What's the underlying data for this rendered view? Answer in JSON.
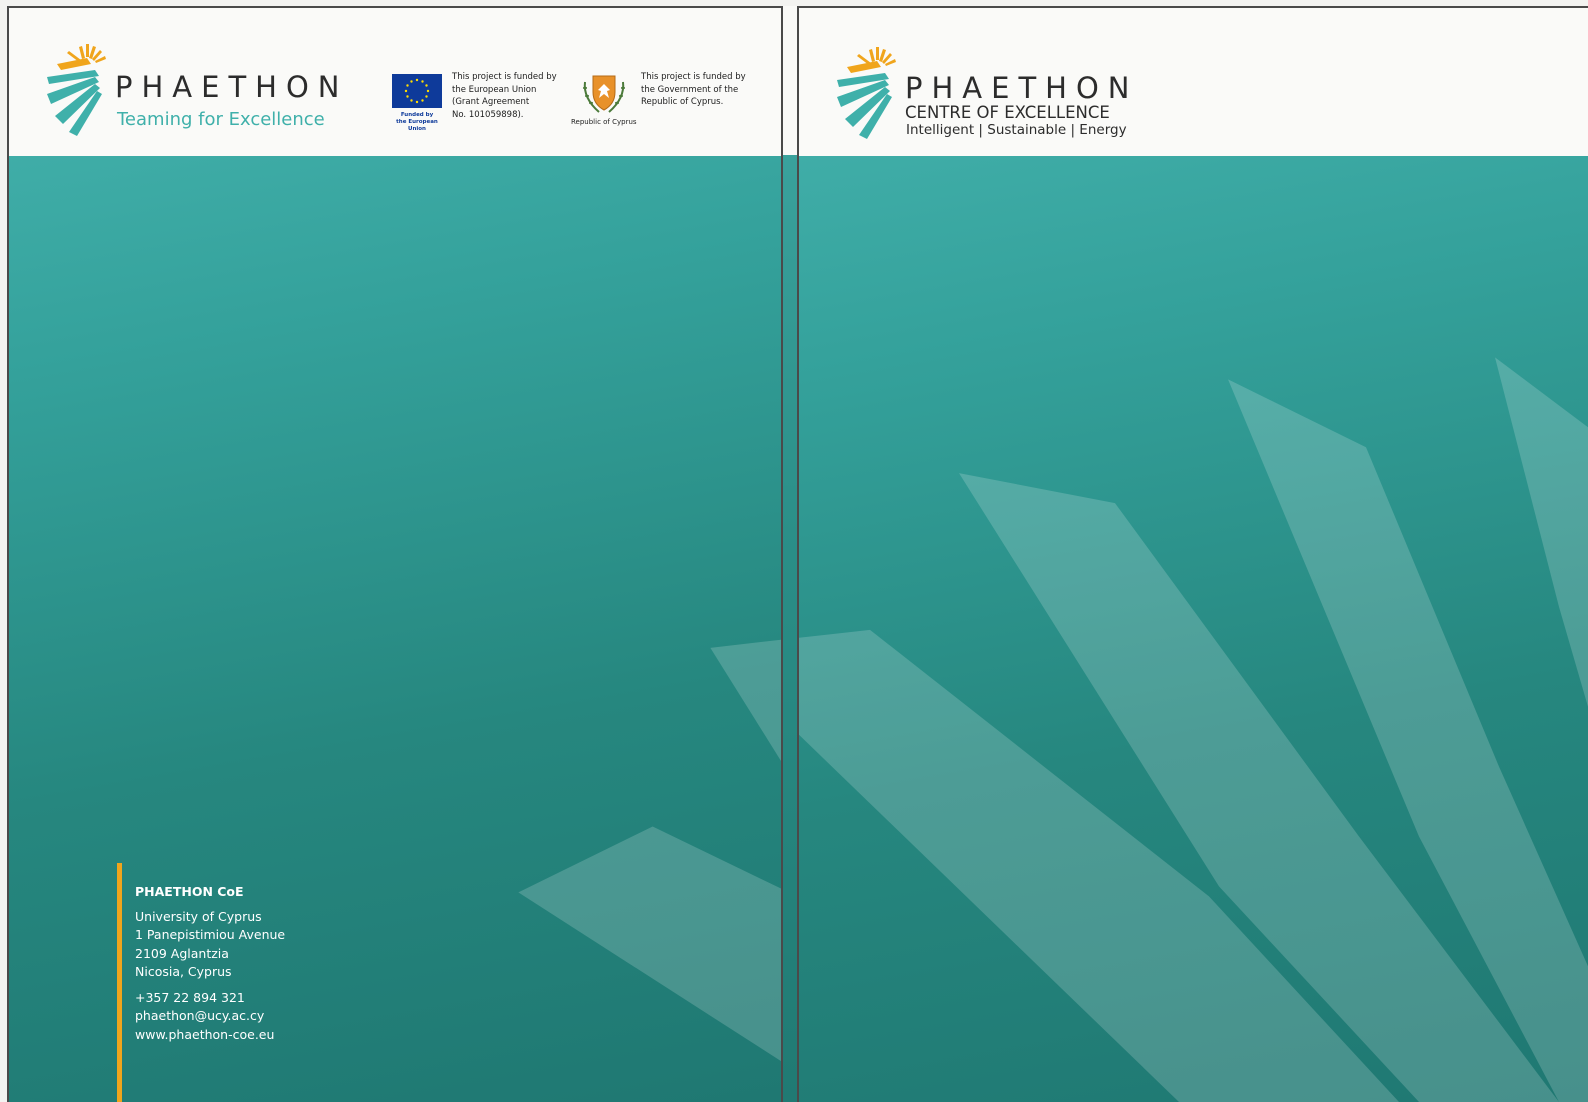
{
  "back_cover": {
    "logo": {
      "name": "PHAETHON",
      "tagline": "Teaming for Excellence"
    },
    "funding": {
      "eu": {
        "flag_icon": "eu-flag-icon",
        "caption_line1": "Funded by",
        "caption_line2": "the European Union",
        "text": [
          "This project is funded by",
          "the European Union",
          "(Grant Agreement",
          "No. 101059898)."
        ]
      },
      "cyprus": {
        "emblem_icon": "cyprus-coat-of-arms-icon",
        "caption": "Republic of Cyprus",
        "text": [
          "This project is funded by",
          "the Government of the",
          "Republic of Cyprus."
        ]
      }
    },
    "contact": {
      "organisation": "PHAETHON CoE",
      "address": [
        "University of Cyprus",
        "1 Panepistimiou Avenue",
        "2109 Aglantzia",
        "Nicosia, Cyprus"
      ],
      "phone": "+357 22 894 321",
      "email": "phaethon@ucy.ac.cy",
      "website": "www.phaethon-coe.eu"
    }
  },
  "front_cover": {
    "logo": {
      "name": "PHAETHON",
      "subtitle": "CENTRE OF EXCELLENCE",
      "keywords": "Intelligent | Sustainable | Energy"
    }
  },
  "colors": {
    "teal_light": "#47b5b0",
    "teal_dark": "#1f7872",
    "orange": "#f0a51c",
    "header_bg": "#fafaf8",
    "logo_teal": "#3fb0aa"
  }
}
